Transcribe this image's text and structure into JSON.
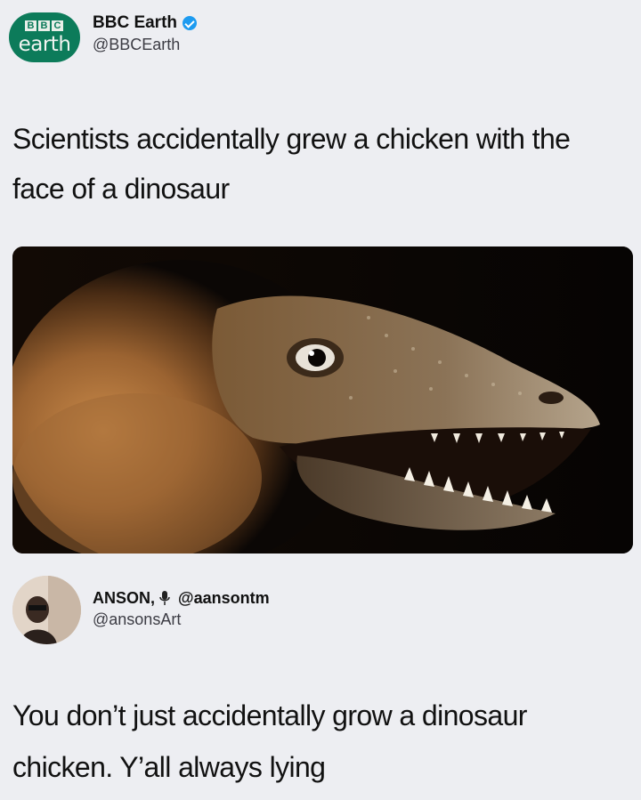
{
  "tweet1": {
    "avatar": {
      "logo_letters": [
        "B",
        "B",
        "C"
      ],
      "logo_word": "earth",
      "background": "#0c7b5a"
    },
    "display_name": "BBC Earth",
    "verified": true,
    "handle": "@BBCEarth",
    "text": "Scientists accidentally grew a chicken with the face of a dinosaur",
    "media": {
      "description_icon": "dinosaur-chicken-photo"
    }
  },
  "tweet2": {
    "display_name": "ANSON,",
    "name_suffix": "@aansontm",
    "handle": "@ansonsArt",
    "text": "You don’t just accidentally grow a dinosaur chicken. Y’all always lying"
  },
  "colors": {
    "background": "#edeef2",
    "verified_blue": "#1d9bf0",
    "text": "#111111",
    "secondary_text": "#3c3c44"
  }
}
